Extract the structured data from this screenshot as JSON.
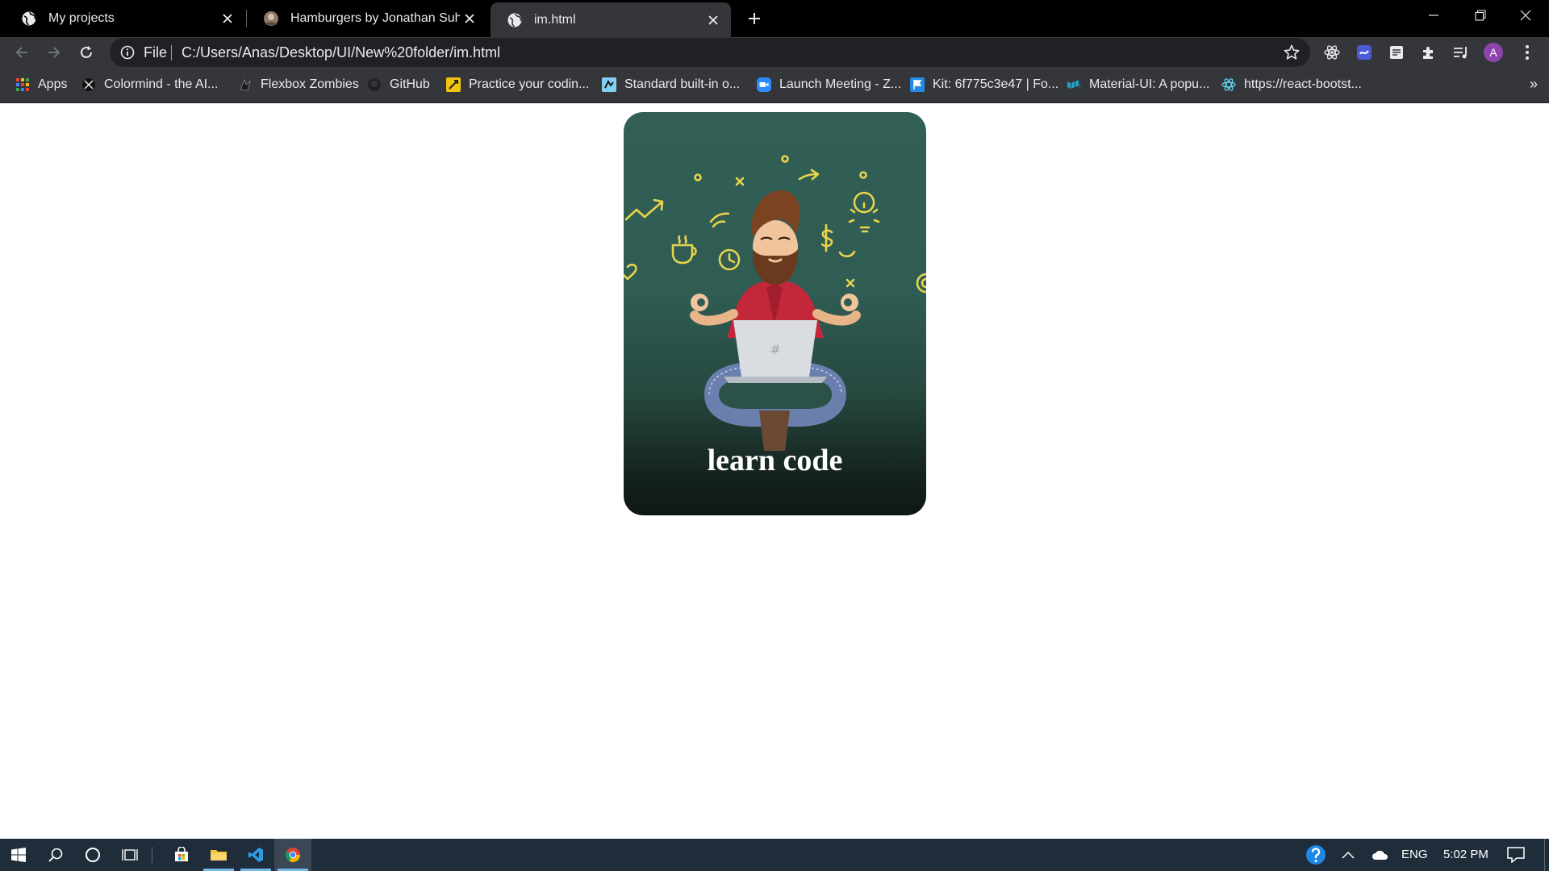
{
  "browser": {
    "tabs": [
      {
        "title": "My projects",
        "icon": "globe-icon"
      },
      {
        "title": "Hamburgers by Jonathan Suh",
        "icon": "avatar-favicon"
      },
      {
        "title": "im.html",
        "icon": "globe-icon",
        "active": true
      }
    ],
    "address": {
      "scheme_label": "File",
      "url": "C:/Users/Anas/Desktop/UI/New%20folder/im.html"
    },
    "profile_initial": "A",
    "bookmarks": [
      {
        "label": "Apps",
        "icon": "apps-grid-icon"
      },
      {
        "label": "Colormind - the AI...",
        "icon": "colormind-icon"
      },
      {
        "label": "Flexbox Zombies",
        "icon": "zombie-icon"
      },
      {
        "label": "GitHub",
        "icon": "github-icon"
      },
      {
        "label": "Practice your codin...",
        "icon": "codewars-icon"
      },
      {
        "label": "Standard built-in o...",
        "icon": "mdn-icon"
      },
      {
        "label": "Launch Meeting - Z...",
        "icon": "zoom-icon"
      },
      {
        "label": "Kit: 6f775c3e47 | Fo...",
        "icon": "fontawesome-flag-icon"
      },
      {
        "label": "Material-UI: A popu...",
        "icon": "material-ui-icon"
      },
      {
        "label": "https://react-bootst...",
        "icon": "react-bootstrap-icon"
      }
    ],
    "bookmarks_overflow": "»"
  },
  "page": {
    "card_title": "learn code",
    "laptop_mark": "#"
  },
  "taskbar": {
    "language": "ENG",
    "time": "5:02 PM"
  },
  "colors": {
    "tab_strip": "#000000",
    "toolbar": "#35363a",
    "card_top": "#315e55",
    "card_bottom": "#0f1614",
    "doodle_yellow": "#e8d44d",
    "taskbar": "#1f2d3a",
    "profile": "#8e44ad"
  }
}
